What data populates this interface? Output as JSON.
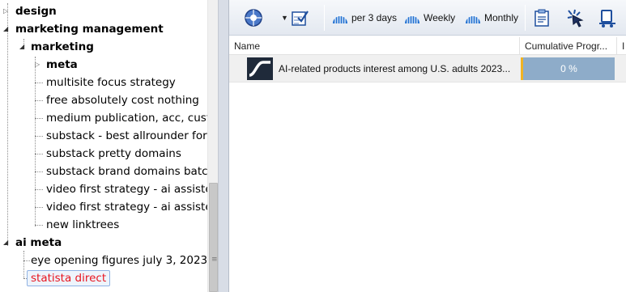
{
  "tree": {
    "nodes": [
      {
        "label": "design",
        "bold": true
      },
      {
        "label": "marketing management",
        "bold": true
      },
      {
        "label": "marketing",
        "bold": true
      },
      {
        "label": "meta",
        "bold": true
      },
      {
        "label": "multisite focus strategy"
      },
      {
        "label": "free absolutely cost nothing"
      },
      {
        "label": "medium publication, acc, custom domain"
      },
      {
        "label": "substack - best allrounder for"
      },
      {
        "label": "substack pretty domains"
      },
      {
        "label": "substack brand domains batch"
      },
      {
        "label": "video first strategy - ai assisted"
      },
      {
        "label": "video first strategy - ai assisted"
      },
      {
        "label": "new linktrees"
      },
      {
        "label": "ai meta",
        "bold": true
      },
      {
        "label": "eye opening figures july 3, 2023"
      },
      {
        "label": "statista direct",
        "selected": true
      }
    ]
  },
  "toolbar": {
    "per3days_label": "per 3 days",
    "weekly_label": "Weekly",
    "monthly_label": "Monthly"
  },
  "grid": {
    "columns": [
      "Name",
      "Cumulative Progr...",
      "I"
    ],
    "rows": [
      {
        "name": "AI-related products interest among U.S. adults 2023...",
        "progress_text": "0 %",
        "progress_value": 0
      }
    ]
  },
  "colors": {
    "selected_text": "#e8141e",
    "progress_fill": "#8eacc9",
    "progress_accent": "#f0b323",
    "toolbar_icon_blue": "#1f6fd1"
  }
}
